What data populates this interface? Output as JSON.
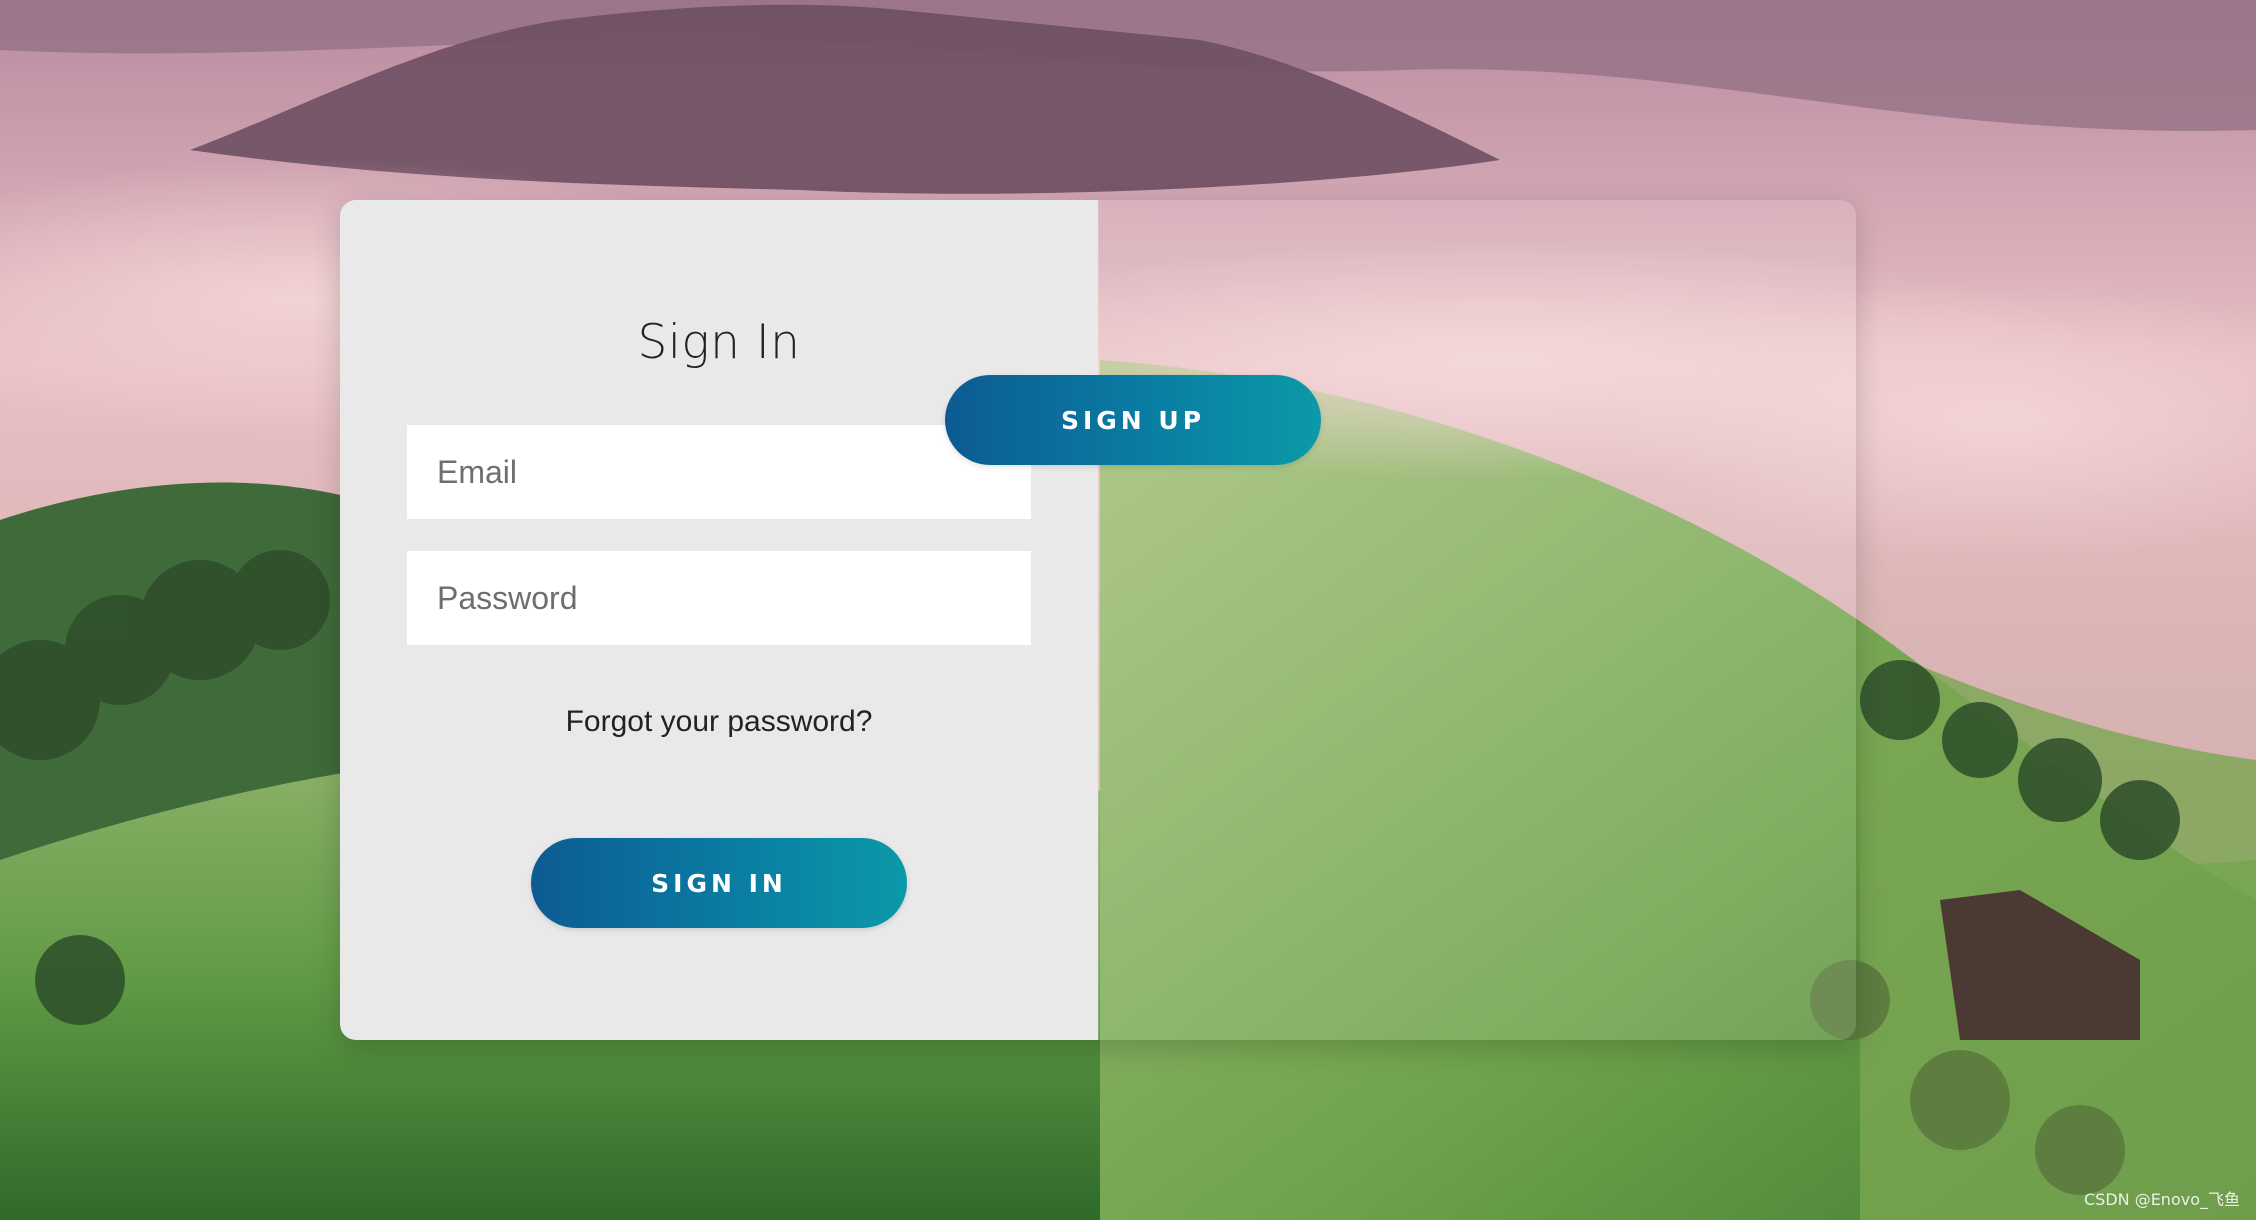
{
  "signin": {
    "title": "Sign In",
    "email_placeholder": "Email",
    "password_placeholder": "Password",
    "forgot_link": "Forgot your password?",
    "button_label": "SIGN IN"
  },
  "overlay": {
    "signup_button_label": "SIGN UP"
  },
  "watermark": "CSDN @Enovo_飞鱼",
  "colors": {
    "button_gradient_start": "#0c5b92",
    "button_gradient_end": "#0b99a8",
    "panel_background": "#e9e9ea"
  }
}
